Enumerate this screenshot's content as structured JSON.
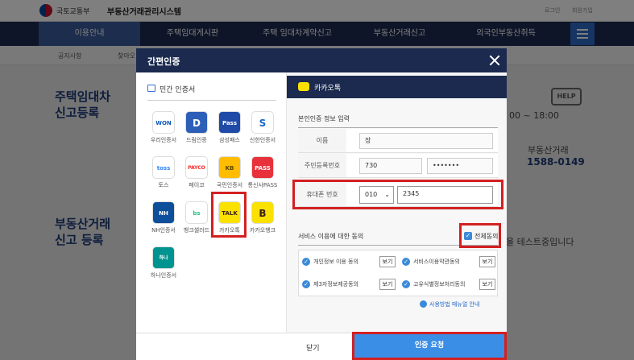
{
  "header": {
    "ministry": "국토교통부",
    "system": "부동산거래관리시스템",
    "links": [
      "로그인",
      "회원가입"
    ]
  },
  "nav": {
    "items": [
      "이용안내",
      "주택임대게시판",
      "주택 임대차계약신고",
      "부동산거래신고",
      "외국인부동산취득"
    ]
  },
  "subnav": {
    "items": [
      "공지사항",
      "찾아오"
    ]
  },
  "background": {
    "title1": [
      "주택임대차",
      "신고등록"
    ],
    "title2": [
      "부동산거래",
      "신고 등록"
    ],
    "hours": "00 ~ 18:00",
    "service": "부동산거래",
    "phone": "1588-0149",
    "notice": "을 테스트중입니다",
    "help": "HELP"
  },
  "modal": {
    "title": "간편인증",
    "left_heading": "민간 인증서",
    "certs": [
      {
        "label": "우리인증서",
        "icon": "WON",
        "color": "#0a5bb5"
      },
      {
        "label": "드림인증",
        "icon": "D",
        "color": "#2d5fb8"
      },
      {
        "label": "삼성패스",
        "icon": "Pass",
        "color": "#1f4aa8"
      },
      {
        "label": "신한인증서",
        "icon": "S",
        "color": "#1a67c9"
      },
      {
        "label": "토스",
        "icon": "toss",
        "color": "#3182f6"
      },
      {
        "label": "페이코",
        "icon": "PAYCO",
        "color": "#fa2828"
      },
      {
        "label": "국민인증서",
        "icon": "KB",
        "color": "#ffbc00"
      },
      {
        "label": "통신사PASS",
        "icon": "PASS",
        "color": "#e8313b"
      },
      {
        "label": "NH인증서",
        "icon": "NH",
        "color": "#0d4f9b"
      },
      {
        "label": "뱅크샐러드",
        "icon": "bs",
        "color": "#26c281"
      },
      {
        "label": "카카오톡",
        "icon": "TALK",
        "color": "#fae100"
      },
      {
        "label": "카카오뱅크",
        "icon": "B",
        "color": "#fae100"
      },
      {
        "label": "하나인증서",
        "icon": "하나",
        "color": "#009490"
      }
    ],
    "provider": "카카오톡",
    "section_title": "본인인증 정보 입력",
    "form": {
      "name_label": "이름",
      "name_value": "장",
      "rrn_label": "주민등록번호",
      "rrn_front": "730",
      "rrn_back": "•••••••",
      "phone_label": "휴대폰 번호",
      "phone_prefix": "010",
      "phone_number": "2345"
    },
    "consent_title": "서비스 이용에 대한 동의",
    "agree_all": "전체동의",
    "consents": [
      {
        "label": "개인정보 이용 동의"
      },
      {
        "label": "서비스이용약관동의"
      },
      {
        "label": "제3자정보제공동의"
      },
      {
        "label": "고유식별정보처리동의"
      }
    ],
    "view_label": "보기",
    "manual": "사용방법 매뉴얼 안내",
    "close_label": "닫기",
    "auth_label": "인증 요청"
  },
  "colors": {
    "accent": "#3a8ee6",
    "navy": "#1b2a4e",
    "highlight": "#d32020"
  }
}
